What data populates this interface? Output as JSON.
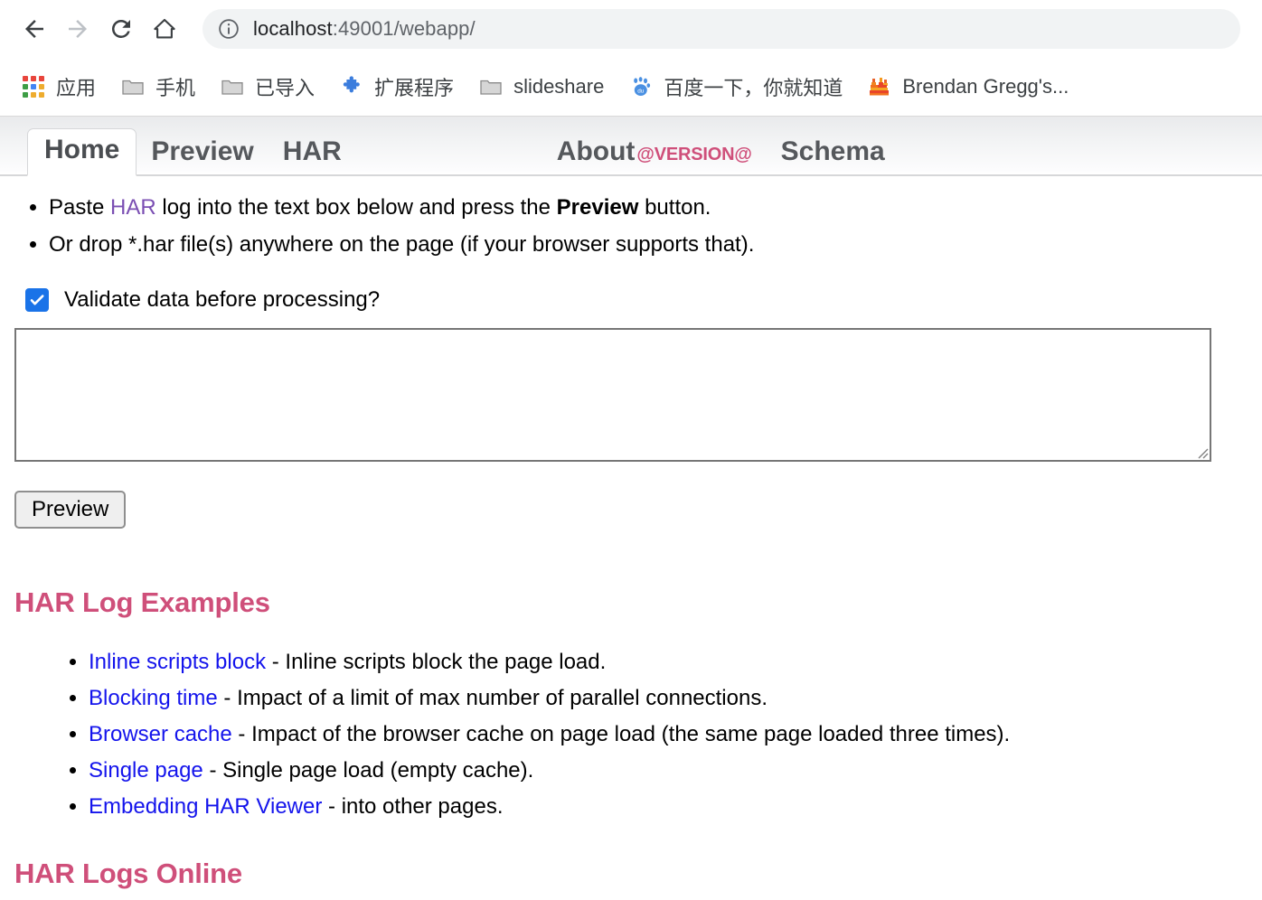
{
  "browser": {
    "nav": {
      "back_label": "Back",
      "forward_label": "Forward",
      "reload_label": "Reload",
      "home_label": "Home"
    },
    "omnibox": {
      "info_icon": "info-circle-icon",
      "url_host": "localhost",
      "url_path": ":49001/webapp/",
      "full_url": "localhost:49001/webapp/"
    },
    "bookmarks": [
      {
        "label": "应用",
        "icon": "apps-grid-icon"
      },
      {
        "label": "手机",
        "icon": "folder-icon"
      },
      {
        "label": "已导入",
        "icon": "folder-icon"
      },
      {
        "label": "扩展程序",
        "icon": "puzzle-piece-icon"
      },
      {
        "label": "slideshare",
        "icon": "folder-icon"
      },
      {
        "label": "百度一下，你就知道",
        "icon": "baidu-paw-icon"
      },
      {
        "label": "Brendan Gregg's...",
        "icon": "flamegraph-icon"
      }
    ]
  },
  "app": {
    "tabs": [
      {
        "id": "home",
        "label": "Home",
        "active": true
      },
      {
        "id": "preview",
        "label": "Preview",
        "active": false
      },
      {
        "id": "har",
        "label": "HAR",
        "active": false
      },
      {
        "id": "about",
        "label": "About",
        "active": false,
        "version": "@VERSION@"
      },
      {
        "id": "schema",
        "label": "Schema",
        "active": false
      }
    ],
    "instructions": {
      "line1_pre": "Paste ",
      "line1_link": "HAR",
      "line1_mid": " log into the text box below and press the ",
      "line1_bold": "Preview",
      "line1_post": " button.",
      "line2": "Or drop *.har file(s) anywhere on the page (if your browser supports that)."
    },
    "validate": {
      "label": "Validate data before processing?",
      "checked": true,
      "check_color": "#1a73e8"
    },
    "textarea": {
      "value": "",
      "placeholder": ""
    },
    "preview_button": {
      "label": "Preview"
    },
    "examples_section": {
      "heading": "HAR Log Examples",
      "heading_color": "#cf4f7a",
      "items": [
        {
          "link": "Inline scripts block",
          "desc": " - Inline scripts block the page load."
        },
        {
          "link": "Blocking time",
          "desc": " - Impact of a limit of max number of parallel connections."
        },
        {
          "link": "Browser cache",
          "desc": " - Impact of the browser cache on page load (the same page loaded three times)."
        },
        {
          "link": "Single page",
          "desc": " - Single page load (empty cache)."
        },
        {
          "link": "Embedding HAR Viewer",
          "desc": " - into other pages."
        }
      ]
    },
    "online_section": {
      "heading": "HAR Logs Online"
    }
  }
}
